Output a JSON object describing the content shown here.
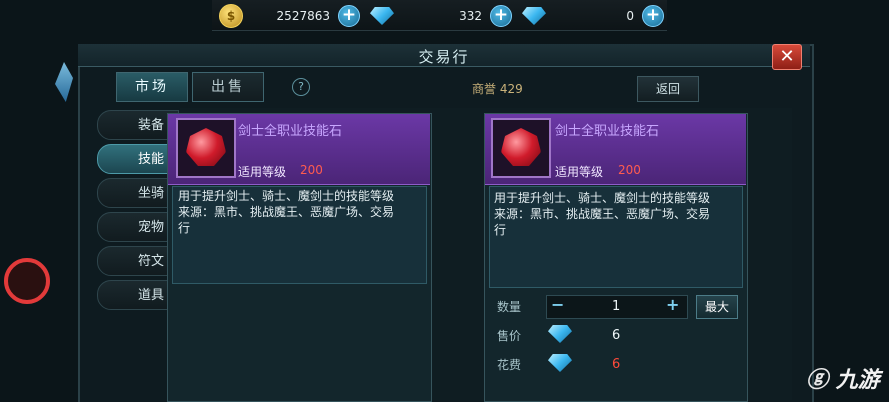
{
  "currency": {
    "gold": "2527863",
    "diamond_bound": "332",
    "diamond": "0",
    "plus_label": "+"
  },
  "window": {
    "title": "交易行",
    "close_label": "✕"
  },
  "tabs": [
    {
      "label": "市场",
      "active": true
    },
    {
      "label": "出售",
      "active": false
    }
  ],
  "reputation": "商誉 429",
  "return_label": "返回",
  "sidebar": {
    "items": [
      {
        "label": "装备",
        "active": false
      },
      {
        "label": "技能",
        "active": true
      },
      {
        "label": "坐骑",
        "active": false
      },
      {
        "label": "宠物",
        "active": false
      },
      {
        "label": "符文",
        "active": false
      },
      {
        "label": "道具",
        "active": false
      }
    ]
  },
  "item_left": {
    "name": "剑士全职业技能石",
    "level_label": "适用等级",
    "level_value": "200",
    "desc_line1": "用于提升剑士、骑士、魔剑士的技能等级",
    "desc_line2": "来源：黑市、挑战魔王、恶魔广场、交易",
    "desc_line3": "行"
  },
  "item_right": {
    "name": "剑士全职业技能石",
    "level_label": "适用等级",
    "level_value": "200",
    "desc_line1": "用于提升剑士、骑士、魔剑士的技能等级",
    "desc_line2": "来源：黑市、挑战魔王、恶魔广场、交易",
    "desc_line3": "行",
    "quantity_label": "数量",
    "quantity_value": "1",
    "minus_label": "−",
    "plus_label": "+",
    "max_label": "最大",
    "price_label": "售价",
    "price_value": "6",
    "cost_label": "花费",
    "cost_value": "6"
  },
  "colors": {
    "accent_purple": "#6b38a6",
    "level_red": "#ff5b4f",
    "cost_red": "#ff4a3a"
  },
  "watermark": "九游"
}
